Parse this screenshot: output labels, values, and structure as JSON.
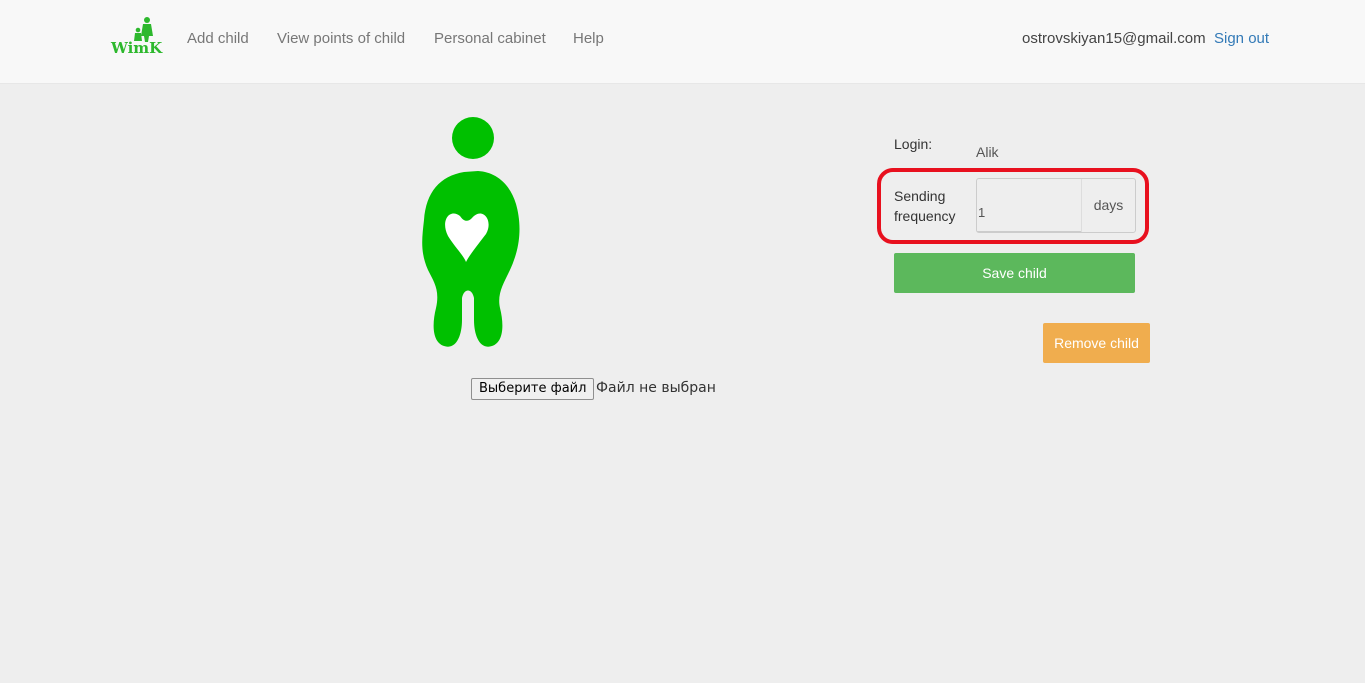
{
  "nav": {
    "brand_text": "WimK",
    "links": [
      "Add child",
      "View points of child",
      "Personal cabinet",
      "Help"
    ],
    "user_email": "ostrovskiyan15@gmail.com",
    "sign_out": "Sign out"
  },
  "file_picker": {
    "button": "Выберите файл",
    "status": "Файл не выбран"
  },
  "form": {
    "login_label": "Login:",
    "login_value": "Alik",
    "frequency_label_line1": "Sending",
    "frequency_label_line2": "frequency",
    "frequency_value": "1",
    "frequency_unit": "days",
    "save_label": "Save child",
    "remove_label": "Remove child"
  },
  "colors": {
    "brand_green": "#2db82d",
    "avatar_green": "#00c000",
    "save": "#5cb85c",
    "remove": "#f0ad4e",
    "highlight": "#e8101e",
    "link": "#337ab7"
  },
  "icons": {
    "brand": "wimk-logo",
    "avatar": "child-avatar-icon"
  }
}
